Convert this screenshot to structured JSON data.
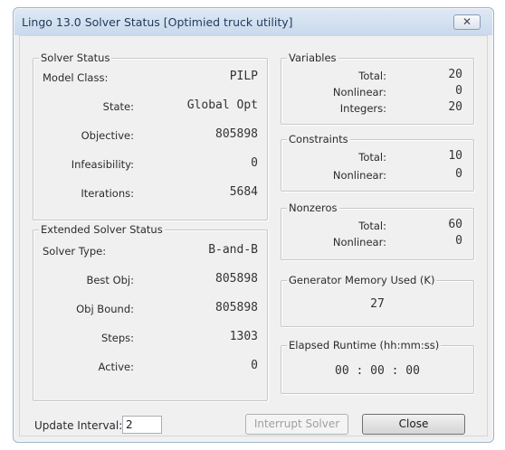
{
  "window": {
    "title": "Lingo 13.0 Solver Status [Optimied truck utility]",
    "close_glyph": "✕"
  },
  "solver_status": {
    "title": "Solver Status",
    "rows": [
      {
        "label": "Model Class:",
        "value": "PILP"
      },
      {
        "label": "State:",
        "value": "Global Opt"
      },
      {
        "label": "Objective:",
        "value": "805898"
      },
      {
        "label": "Infeasibility:",
        "value": "0"
      },
      {
        "label": "Iterations:",
        "value": "5684"
      }
    ]
  },
  "extended_status": {
    "title": "Extended Solver Status",
    "rows": [
      {
        "label": "Solver Type:",
        "value": "B-and-B"
      },
      {
        "label": "Best Obj:",
        "value": "805898"
      },
      {
        "label": "Obj Bound:",
        "value": "805898"
      },
      {
        "label": "Steps:",
        "value": "1303"
      },
      {
        "label": "Active:",
        "value": "0"
      }
    ]
  },
  "variables": {
    "title": "Variables",
    "rows": [
      {
        "label": "Total:",
        "value": "20"
      },
      {
        "label": "Nonlinear:",
        "value": "0"
      },
      {
        "label": "Integers:",
        "value": "20"
      }
    ]
  },
  "constraints": {
    "title": "Constraints",
    "rows": [
      {
        "label": "Total:",
        "value": "10"
      },
      {
        "label": "Nonlinear:",
        "value": "0"
      }
    ]
  },
  "nonzeros": {
    "title": "Nonzeros",
    "rows": [
      {
        "label": "Total:",
        "value": "60"
      },
      {
        "label": "Nonlinear:",
        "value": "0"
      }
    ]
  },
  "memory": {
    "title": "Generator Memory Used (K)",
    "value": "27"
  },
  "runtime": {
    "title": "Elapsed Runtime (hh:mm:ss)",
    "value": "00 : 00 : 00"
  },
  "footer": {
    "update_interval_label": "Update Interval:",
    "update_interval_value": "2",
    "interrupt_label": "Interrupt Solver",
    "close_label": "Close"
  }
}
